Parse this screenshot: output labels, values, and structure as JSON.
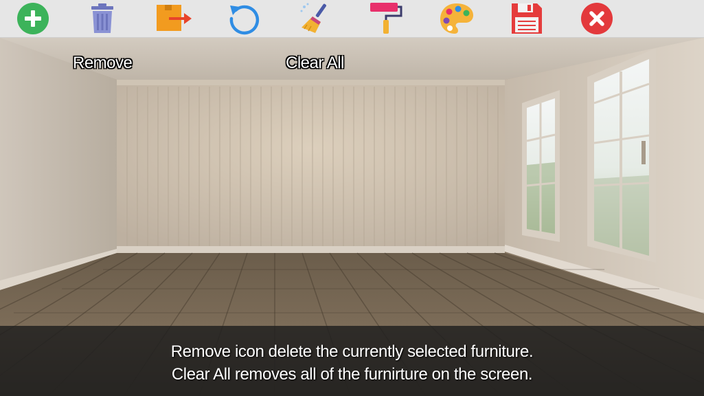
{
  "toolbar": {
    "items": [
      {
        "name": "add-icon",
        "color": "#3cb35a"
      },
      {
        "name": "trash-icon",
        "color": "#7f86c9"
      },
      {
        "name": "export-icon",
        "color": "#f29b1f"
      },
      {
        "name": "undo-icon",
        "color": "#2f8de4"
      },
      {
        "name": "broom-icon",
        "color": "#f2b132"
      },
      {
        "name": "paint-roller-icon",
        "color": "#e8306b"
      },
      {
        "name": "palette-icon",
        "color": "#f5b33a"
      },
      {
        "name": "floppy-disk-icon",
        "color": "#e53c3c"
      },
      {
        "name": "close-icon",
        "color": "#e3393c"
      }
    ]
  },
  "tooltips": {
    "remove": "Remove",
    "clear_all": "Clear All"
  },
  "caption": {
    "line1": "Remove icon delete the currently selected furniture.",
    "line2": "Clear All removes all of the furnirture on the screen."
  }
}
